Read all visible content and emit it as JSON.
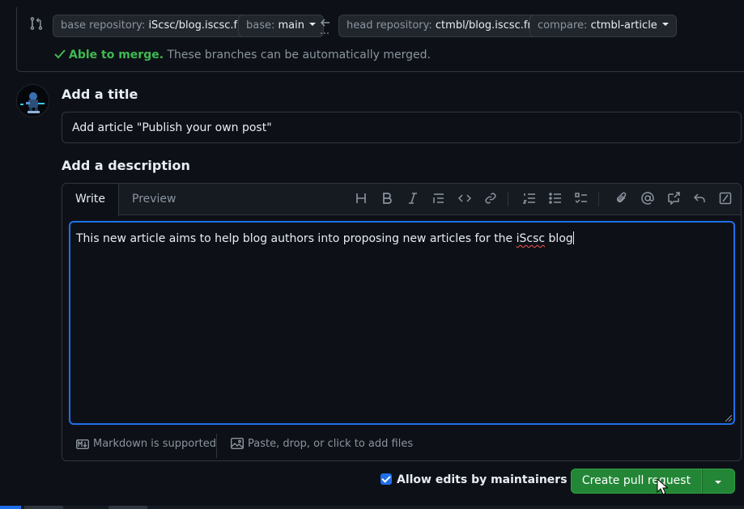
{
  "compare": {
    "base_repo_label": "base repository:",
    "base_repo_value": "iScsc/blog.iscsc.fr",
    "base_label": "base:",
    "base_value": "main",
    "head_repo_label": "head repository:",
    "head_repo_value": "ctmbl/blog.iscsc.fr",
    "compare_label": "compare:",
    "compare_value": "ctmbl-article",
    "merge_status_strong": "Able to merge.",
    "merge_status_text": "These branches can be automatically merged."
  },
  "form": {
    "title_label": "Add a title",
    "title_value": "Add article \"Publish your own post\"",
    "description_label": "Add a description"
  },
  "editor": {
    "tabs": [
      {
        "label": "Write",
        "active": true
      },
      {
        "label": "Preview",
        "active": false
      }
    ],
    "toolbar": [
      "heading-icon",
      "bold-icon",
      "italic-icon",
      "quote-icon",
      "code-icon",
      "link-icon",
      "ordered-list-icon",
      "unordered-list-icon",
      "task-list-icon",
      "attach-icon",
      "mention-icon",
      "reference-icon",
      "reply-icon",
      "slash-command-icon"
    ],
    "body_text_before": "This new article aims to help blog authors into proposing new articles for the ",
    "body_misspelled": "iScsc",
    "body_text_after": " blog",
    "markdown_note": "Markdown is supported",
    "attach_note": "Paste, drop, or click to add files"
  },
  "actions": {
    "allow_edits_label": "Allow edits by maintainers",
    "allow_edits_checked": true,
    "help_glyph": "?",
    "create_label": "Create pull request"
  },
  "colors": {
    "background": "#0d1117",
    "accent": "#1f6feb",
    "success": "#3fb950",
    "button_green": "#238636"
  }
}
